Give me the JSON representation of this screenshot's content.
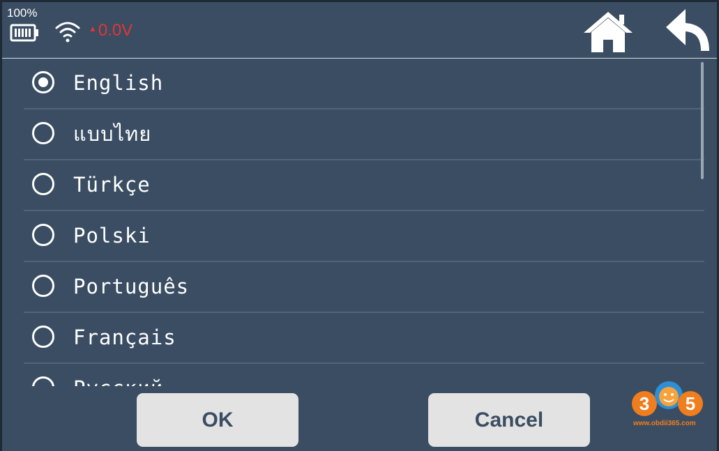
{
  "status": {
    "battery_percent": "100%",
    "voltage": "0.0V",
    "voltage_color": "#e23636"
  },
  "nav": {
    "home_icon": "home-icon",
    "back_icon": "back-arrow-icon"
  },
  "languages": [
    {
      "label": "English",
      "selected": true
    },
    {
      "label": "แบบไทย",
      "selected": false
    },
    {
      "label": "Türkçe",
      "selected": false
    },
    {
      "label": "Polski",
      "selected": false
    },
    {
      "label": "Português",
      "selected": false
    },
    {
      "label": "Français",
      "selected": false
    },
    {
      "label": "Русский",
      "selected": false
    }
  ],
  "buttons": {
    "ok_label": "OK",
    "cancel_label": "Cancel"
  },
  "watermark": {
    "logo_digits": "365",
    "site": "www.obdii365.com"
  },
  "colors": {
    "background": "#3a4d62",
    "accent_text": "#ffffff",
    "button_bg": "#e3e3e3"
  }
}
